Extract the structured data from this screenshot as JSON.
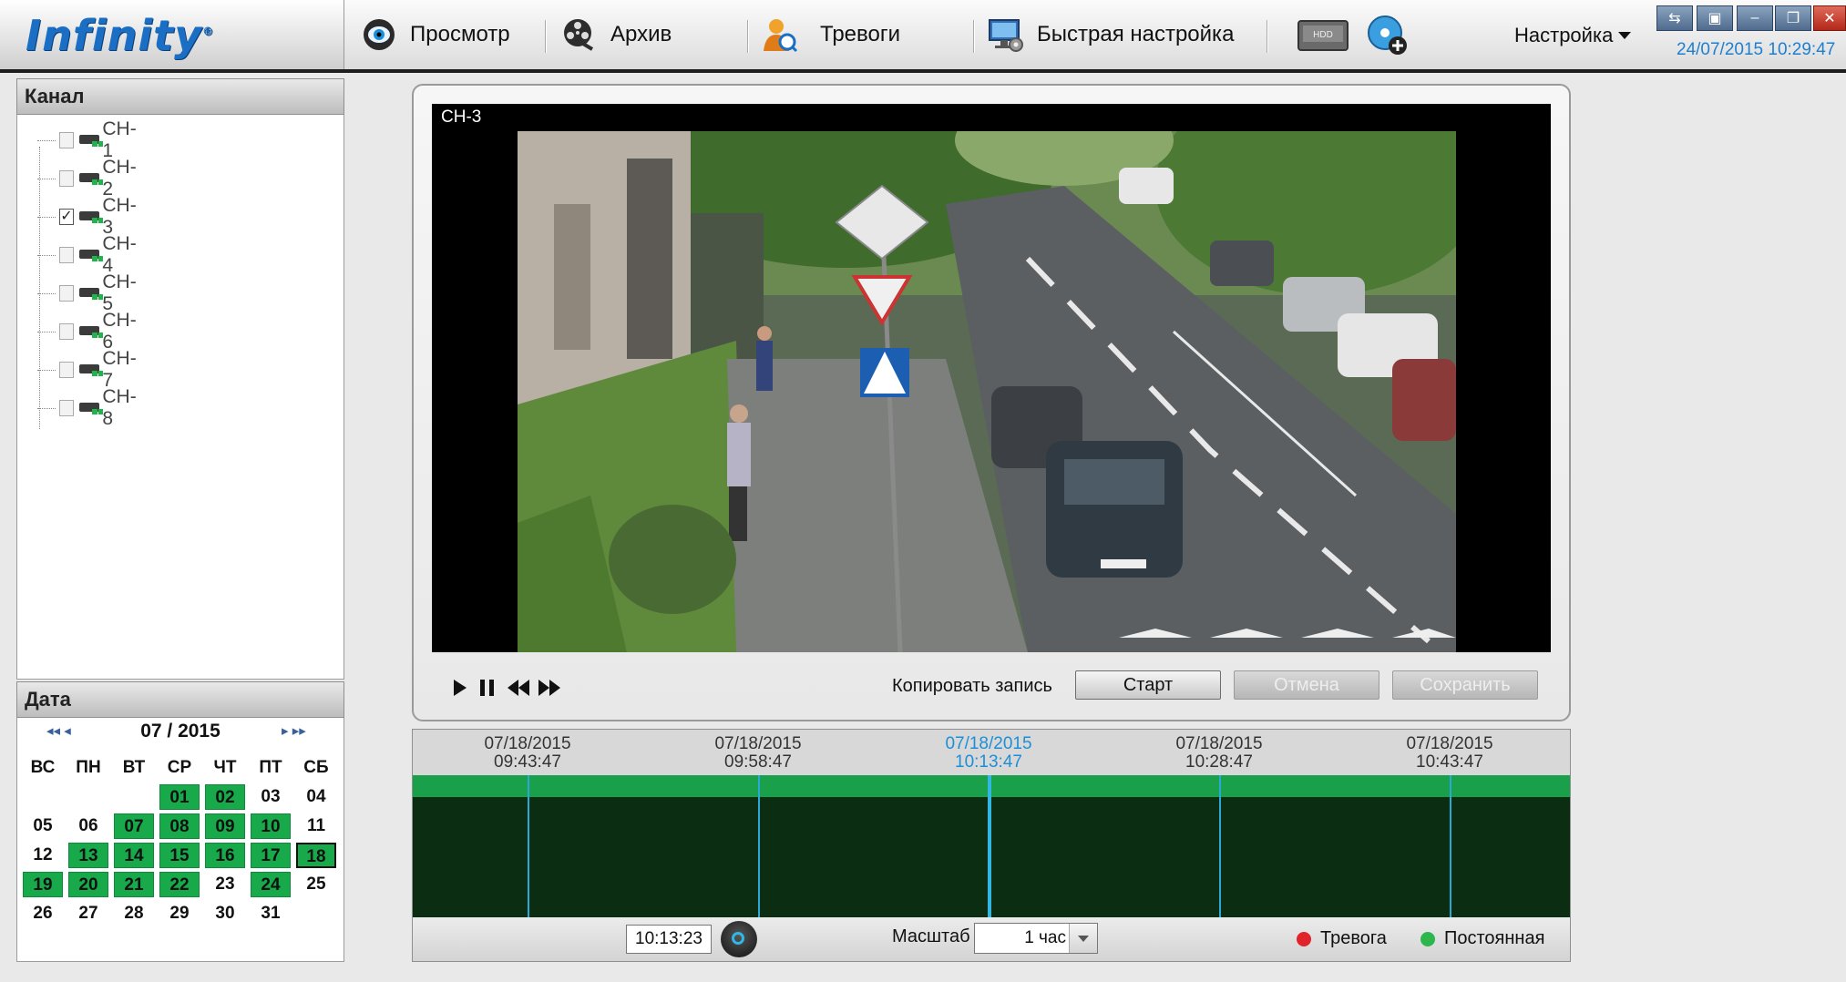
{
  "app": {
    "logo": "Infinity",
    "logo_mark": "®"
  },
  "nav": [
    {
      "label": "Просмотр",
      "icon": "eye-icon"
    },
    {
      "label": "Архив",
      "icon": "archive-reel-icon"
    },
    {
      "label": "Тревоги",
      "icon": "alarm-user-icon"
    },
    {
      "label": "Быстрая настройка",
      "icon": "quick-setup-monitor-icon"
    }
  ],
  "toolbar_icons": [
    "hdd-icon",
    "disc-add-icon"
  ],
  "settings_label": "Настройка",
  "datetime": "24/07/2015 10:29:47",
  "window_buttons": [
    "⇆",
    "▣",
    "–",
    "❐",
    "✕"
  ],
  "channel_panel": {
    "title": "Канал",
    "channels": [
      {
        "label": "CH-1",
        "checked": false
      },
      {
        "label": "CH-2",
        "checked": false
      },
      {
        "label": "CH-3",
        "checked": true
      },
      {
        "label": "CH-4",
        "checked": false
      },
      {
        "label": "CH-5",
        "checked": false
      },
      {
        "label": "CH-6",
        "checked": false
      },
      {
        "label": "CH-7",
        "checked": false
      },
      {
        "label": "CH-8",
        "checked": false
      }
    ]
  },
  "date_panel": {
    "title": "Дата",
    "month": "07 / 2015",
    "nav_prev": "◂◂ ◂",
    "nav_next": "▸ ▸▸",
    "weekdays": [
      "ВС",
      "ПН",
      "ВТ",
      "СР",
      "ЧТ",
      "ПТ",
      "СБ"
    ],
    "first_weekday_index": 3,
    "days_in_month": 31,
    "recorded_days": [
      1,
      2,
      7,
      8,
      9,
      10,
      13,
      14,
      15,
      16,
      17,
      18,
      19,
      20,
      21,
      22,
      24
    ],
    "selected_day": 18
  },
  "player": {
    "channel_title": "CH-3",
    "copy_label": "Копировать запись",
    "start_label": "Старт",
    "cancel_label": "Отмена",
    "save_label": "Сохранить"
  },
  "timeline": {
    "labels": [
      {
        "date": "07/18/2015",
        "time": "09:43:47",
        "active": false
      },
      {
        "date": "07/18/2015",
        "time": "09:58:47",
        "active": false
      },
      {
        "date": "07/18/2015",
        "time": "10:13:47",
        "active": true
      },
      {
        "date": "07/18/2015",
        "time": "10:28:47",
        "active": false
      },
      {
        "date": "07/18/2015",
        "time": "10:43:47",
        "active": false
      }
    ],
    "current_time": "10:13:23",
    "scale_label": "Масштаб",
    "scale_value": "1 час",
    "legend": [
      {
        "label": "Тревога",
        "color": "#e0242a"
      },
      {
        "label": "Постоянная",
        "color": "#2cb64c"
      }
    ]
  }
}
